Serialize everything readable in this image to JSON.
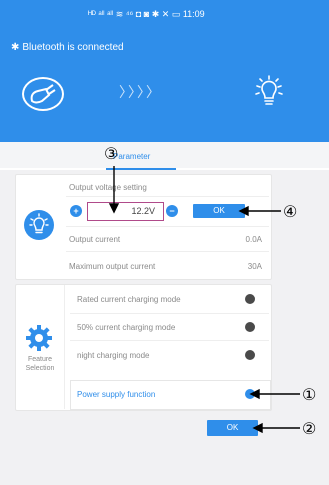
{
  "status_bar": {
    "text": "ᴴᴰ ᵃˡˡ ᵃˡˡ ≋ ⁴⁶ ◘   ◙ ✱ ✕ ▭ 11:09"
  },
  "header": {
    "bluetooth_text": "Bluetooth is connected",
    "arrows": "〉〉〉〉"
  },
  "tab": {
    "label": "Parameter"
  },
  "voltage_card": {
    "setting_label": "Output voltage setting",
    "value": "12.2V",
    "plus": "+",
    "minus": "−",
    "ok_label": "OK",
    "current_label": "Output current",
    "current_value": "0.0A",
    "max_label": "Maximum output current",
    "max_value": "30A"
  },
  "feature_card": {
    "title": "Feature Selection",
    "modes": [
      {
        "label": "Rated current charging mode"
      },
      {
        "label": "50% current charging mode"
      },
      {
        "label": "night charging mode"
      }
    ],
    "power_supply_label": "Power supply function"
  },
  "footer": {
    "ok_label": "OK"
  },
  "callouts": {
    "c1": "①",
    "c2": "②",
    "c3": "③",
    "c4": "④"
  },
  "colors": {
    "accent": "#2f8eea",
    "toggle_off": "#4a4a4a",
    "voltage_border": "#b04a8a"
  }
}
